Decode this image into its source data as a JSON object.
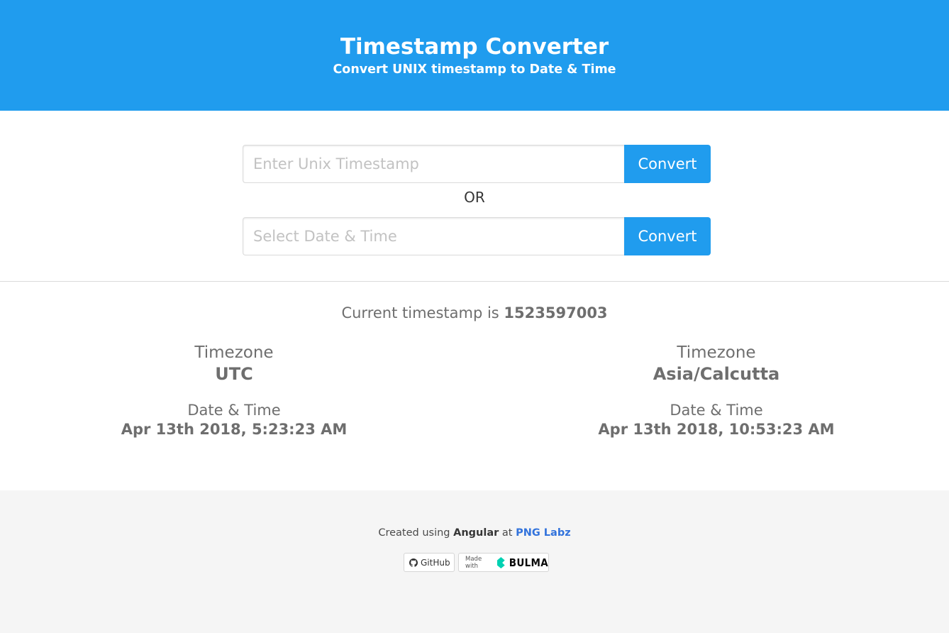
{
  "hero": {
    "title": "Timestamp Converter",
    "subtitle": "Convert UNIX timestamp to Date & Time"
  },
  "form": {
    "timestamp_placeholder": "Enter Unix Timestamp",
    "timestamp_value": "",
    "convert1_label": "Convert",
    "or_label": "OR",
    "date_placeholder": "Select Date & Time",
    "date_value": "",
    "convert2_label": "Convert"
  },
  "current": {
    "prefix": "Current timestamp is",
    "value": "1523597003"
  },
  "zones": [
    {
      "tz_label": "Timezone",
      "tz_value": "UTC",
      "dt_label": "Date & Time",
      "dt_value": "Apr 13th 2018, 5:23:23 AM"
    },
    {
      "tz_label": "Timezone",
      "tz_value": "Asia/Calcutta",
      "dt_label": "Date & Time",
      "dt_value": "Apr 13th 2018, 10:53:23 AM"
    }
  ],
  "footer": {
    "created_prefix": "Created using",
    "framework": "Angular",
    "at": "at",
    "author": "PNG Labz",
    "github_label": "GitHub",
    "made_with": "Made with",
    "bulma": "BULMA"
  },
  "colors": {
    "primary": "#209cee",
    "link": "#3273dc",
    "footer_bg": "#f5f5f5",
    "bulma_logo": "#00d1b2"
  },
  "icons": {
    "github": "github-icon",
    "bulma": "bulma-logo-icon"
  }
}
